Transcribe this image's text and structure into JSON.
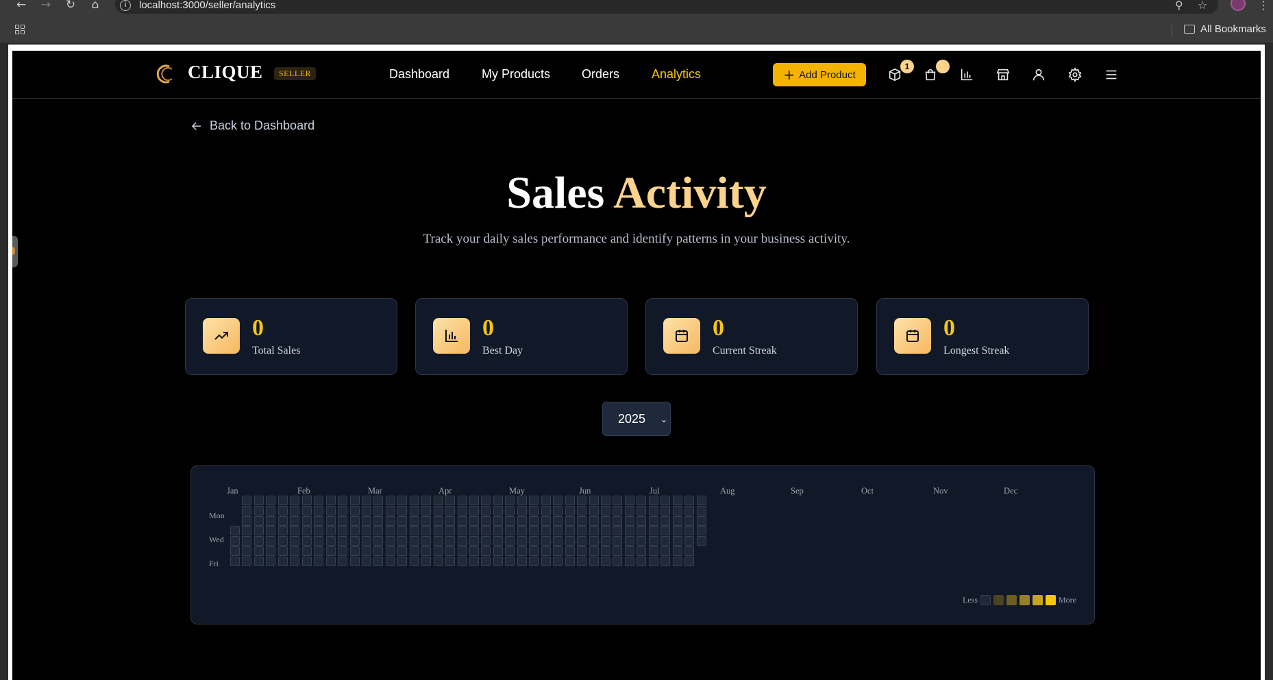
{
  "browser": {
    "url": "localhost:3000/seller/analytics",
    "bookmarks_label": "All Bookmarks"
  },
  "header": {
    "brand": "CLIQUE",
    "badge": "SELLER",
    "nav": [
      "Dashboard",
      "My Products",
      "Orders",
      "Analytics"
    ],
    "active_nav": "Analytics",
    "add_product_label": "Add Product",
    "cart_count": "1",
    "icons": [
      "box-icon",
      "shopping-bag-icon",
      "bar-chart-icon",
      "store-icon",
      "user-icon",
      "gear-icon",
      "menu-icon"
    ]
  },
  "back_link": "Back to Dashboard",
  "title": {
    "main": "Sales",
    "accent": "Activity"
  },
  "subtitle": "Track your daily sales performance and identify patterns in your business activity.",
  "stats": [
    {
      "value": "0",
      "label": "Total Sales",
      "icon": "trending-up-icon"
    },
    {
      "value": "0",
      "label": "Best Day",
      "icon": "bar-chart-icon"
    },
    {
      "value": "0",
      "label": "Current Streak",
      "icon": "calendar-icon"
    },
    {
      "value": "0",
      "label": "Longest Streak",
      "icon": "calendar-icon"
    }
  ],
  "year_select": {
    "selected": "2025"
  },
  "heatmap": {
    "months": [
      "Jan",
      "Feb",
      "Mar",
      "Apr",
      "May",
      "Jun",
      "Jul",
      "Aug",
      "Sep",
      "Oct",
      "Nov",
      "Dec"
    ],
    "day_labels": [
      "Mon",
      "Wed",
      "Fri"
    ],
    "legend_less": "Less",
    "legend_more": "More",
    "legend_colors": [
      "#1f2937",
      "#4a4423",
      "#6b5e22",
      "#958124",
      "#c9a51d",
      "#f5c518"
    ],
    "year_start_weekday": 3,
    "days_with_data": 275,
    "daily_sales": "all 0"
  },
  "colors": {
    "accent": "#f5c518",
    "accent_soft": "#fbd38d",
    "card_bg": "#111827",
    "page_bg": "#000000"
  }
}
